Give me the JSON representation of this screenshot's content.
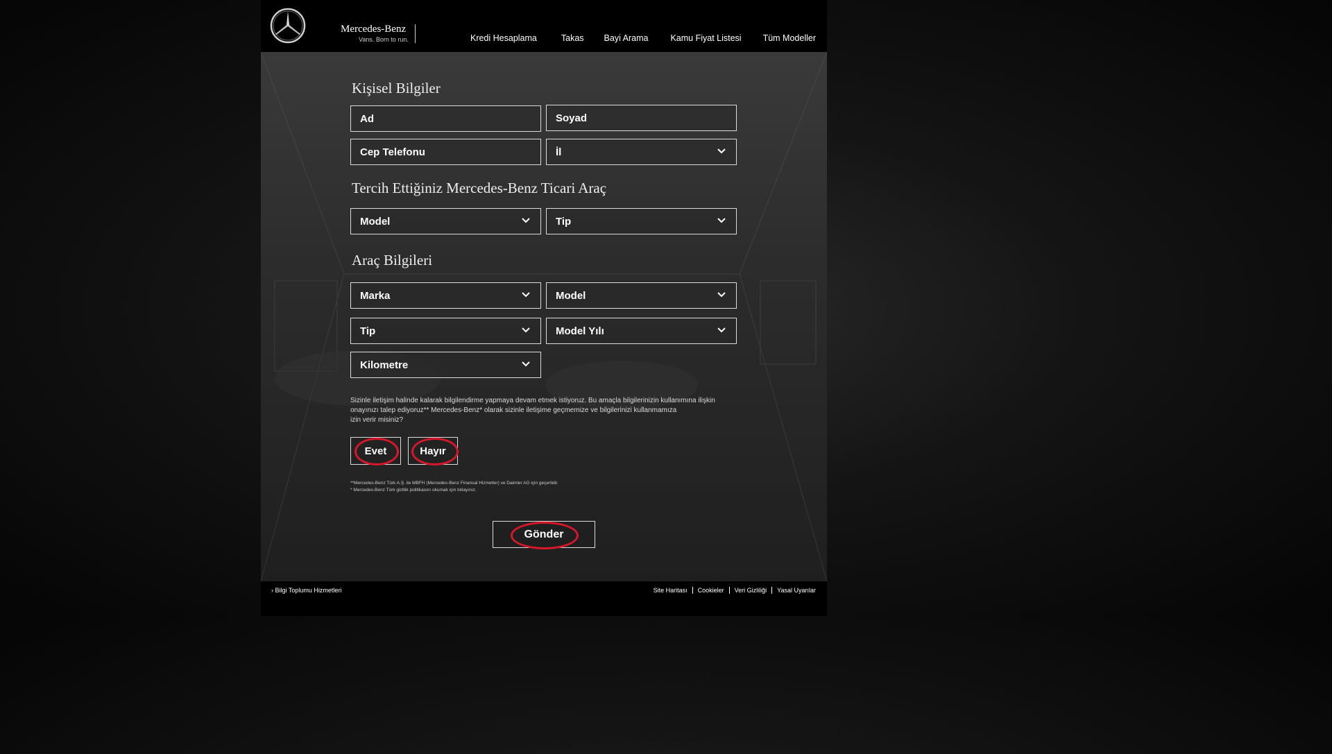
{
  "brand": {
    "name": "Mercedes-Benz",
    "tagline": "Vans. Born to run."
  },
  "nav": {
    "items": [
      {
        "label": "Kredi Hesaplama"
      },
      {
        "label": "Takas"
      },
      {
        "label": "Bayi Arama"
      },
      {
        "label": "Kamu Fiyat Listesi"
      },
      {
        "label": "Tüm Modeller"
      }
    ]
  },
  "form": {
    "personal_title": "Kişisel Bilgiler",
    "first_name_placeholder": "Ad",
    "last_name_placeholder": "Soyad",
    "phone_placeholder": "Cep Telefonu",
    "city_placeholder": "İl",
    "preferred_title": "Tercih Ettiğiniz Mercedes-Benz Ticari Araç",
    "pref_model": "Model",
    "pref_type": "Tip",
    "vehicle_title": "Araç Bilgileri",
    "veh_brand": "Marka",
    "veh_model": "Model",
    "veh_type": "Tip",
    "veh_year": "Model Yılı",
    "veh_km": "Kilometre",
    "consent_line1": "Sizinle iletişim halinde kalarak bilgilendirme yapmaya devam etmek istiyoruz. Bu amaçla bilgilerinizin kullanımına ilişkin",
    "consent_line2": "onayınızı talep ediyoruz** Mercedes-Benz* olarak sizinle iletişime geçmemize ve bilgilerinizi kullanmamıza",
    "consent_line3": "izin verir misiniz?",
    "yes_label": "Evet",
    "no_label": "Hayır",
    "fine_line1": "**Mercedes-Benz Türk A.Ş. ile MBFH (Mercedes-Benz Finansal Hizmetler) ve Daimler AG için geçerlidir.",
    "fine_line2": "* Mercedes-Benz Türk gizlilik politikasını okumak için tıklayınız.",
    "submit_label": "Gönder"
  },
  "footer": {
    "left_link": "Bilgi Toplumu Hizmetleri",
    "links": [
      {
        "label": "Site Haritası"
      },
      {
        "label": "Cookieler"
      },
      {
        "label": "Veri Gizliliği"
      },
      {
        "label": "Yasal Uyarılar"
      }
    ]
  },
  "colors": {
    "highlight": "#d8182a",
    "header": "#000000"
  }
}
